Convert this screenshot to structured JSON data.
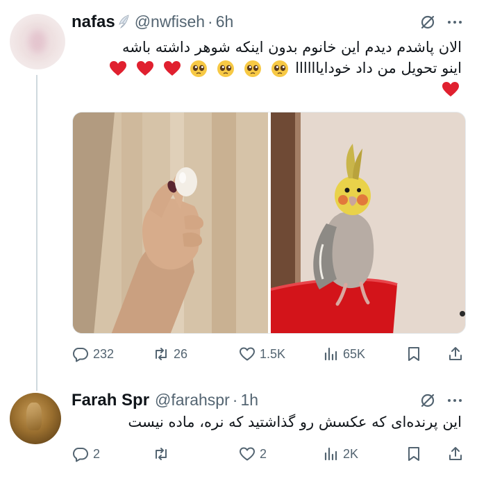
{
  "tweets": [
    {
      "author_name": "nafas",
      "handle": "@nwfiseh",
      "separator": "·",
      "time": "6h",
      "text_line1": "الان پاشدم دیدم این خانوم بدون اینکه شوهر داشته باشه",
      "text_line2": "اینو تحویل من داد خودایاااااا",
      "emoji_line2": [
        "pleading-face",
        "pleading-face",
        "pleading-face",
        "pleading-face",
        "red-heart",
        "red-heart",
        "red-heart"
      ],
      "emoji_line3": [
        "red-heart"
      ],
      "images": [
        {
          "name": "hand-holding-egg-photo"
        },
        {
          "name": "cockatiel-on-red-cup-photo"
        }
      ],
      "stats": {
        "replies": "232",
        "retweets": "26",
        "likes": "1.5K",
        "views": "65K"
      }
    },
    {
      "author_name": "Farah Spr",
      "handle": "@farahspr",
      "separator": "·",
      "time": "1h",
      "text_line1": "این پرنده‌ای که عکسش رو گذاشتید که نره، ماده نیست",
      "stats": {
        "replies": "2",
        "retweets": "",
        "likes": "2",
        "views": "2K"
      }
    }
  ],
  "icons": {
    "verified_badge": "angel-wing-emoji",
    "reply": "speech-bubble-icon",
    "retweet": "retweet-arrows-icon",
    "like": "heart-outline-icon",
    "views": "bar-chart-icon",
    "bookmark": "bookmark-icon",
    "share": "share-upload-icon",
    "grok": "grok-slash-icon",
    "more": "more-dots-icon"
  },
  "colors": {
    "text": "#0f1419",
    "secondary": "#536471",
    "thread_line": "#cfd9de",
    "heart_red": "#e0202f"
  }
}
